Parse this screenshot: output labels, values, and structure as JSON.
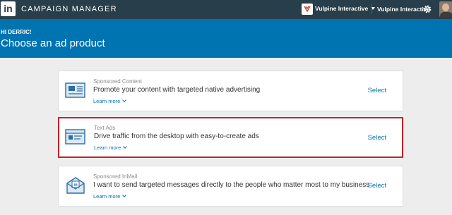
{
  "header": {
    "logo_text": "in",
    "app_title": "CAMPAIGN MANAGER",
    "account_switcher": "Vulpine Interactive",
    "account_name": "Vulpine Interactive"
  },
  "hero": {
    "greeting": "HI DERRIC!",
    "title": "Choose an ad product"
  },
  "products": [
    {
      "label": "Sponsored Content",
      "description": "Promote your content with targeted native advertising",
      "learn_more": "Learn more",
      "select": "Select",
      "icon": "newspaper-icon"
    },
    {
      "label": "Text Ads",
      "description": "Drive traffic from the desktop with easy-to-create ads",
      "learn_more": "Learn more",
      "select": "Select",
      "icon": "browser-window-icon",
      "highlighted": true,
      "highlight_color": "#c62026"
    },
    {
      "label": "Sponsored InMail",
      "description": "I want to send targeted messages directly to the people who matter most to my business",
      "learn_more": "Learn more",
      "select": "Select",
      "icon": "linkedin-envelope-icon"
    }
  ],
  "colors": {
    "topbar": "#283e4a",
    "hero": "#0073b1",
    "link": "#0073b1",
    "background": "#ededed"
  }
}
